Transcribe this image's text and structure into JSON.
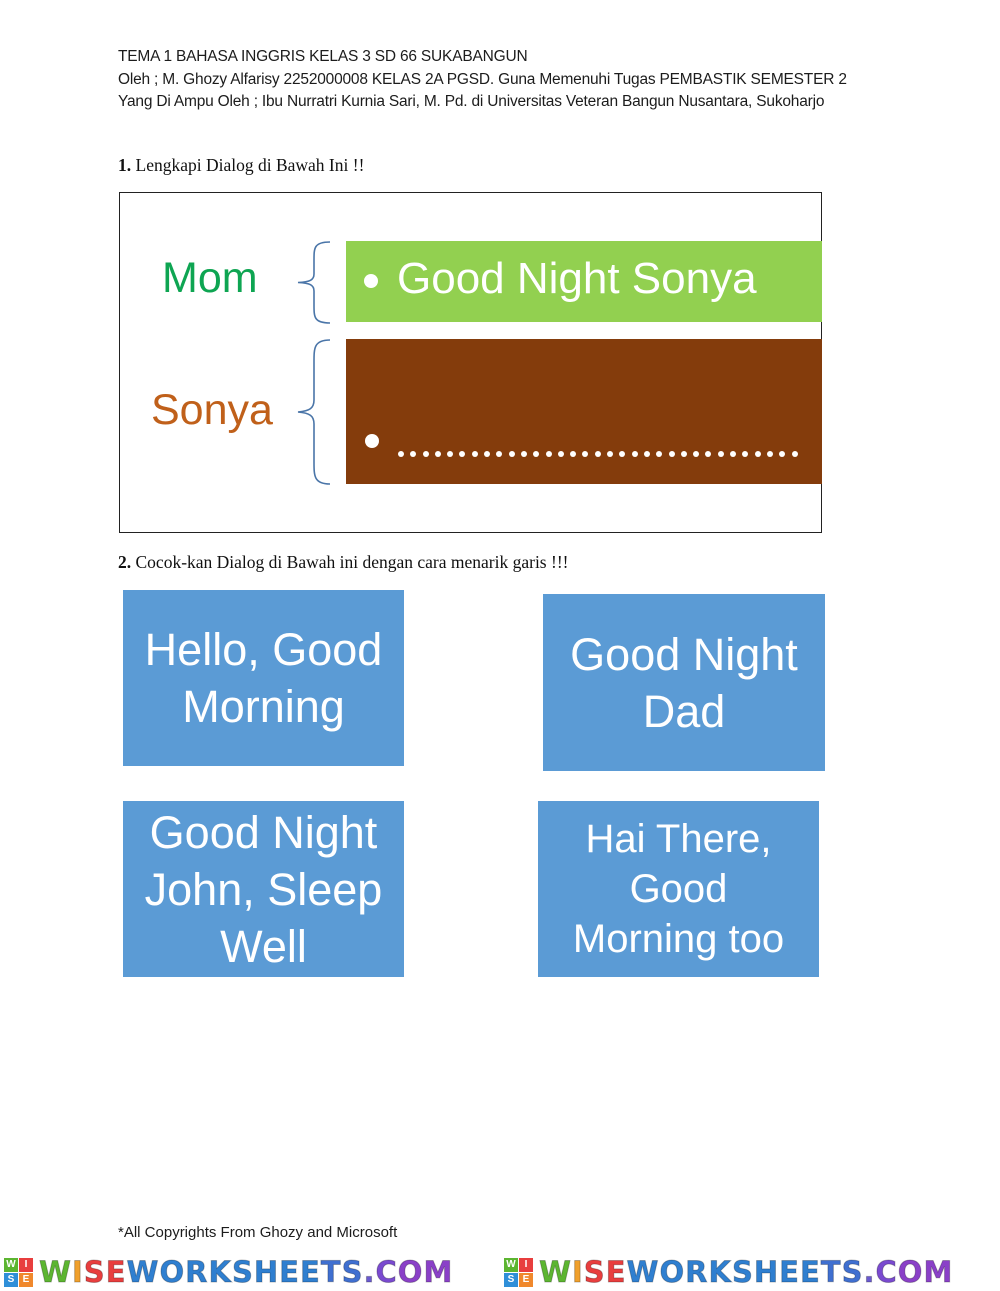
{
  "header": {
    "line1": "TEMA 1 BAHASA INGGRIS KELAS 3 SD 66 SUKABANGUN",
    "line2": "Oleh ; M. Ghozy Alfarisy 2252000008 KELAS 2A PGSD. Guna Memenuhi Tugas PEMBASTIK SEMESTER 2",
    "line3": "Yang Di Ampu Oleh ; Ibu Nurratri Kurnia Sari, M. Pd. di Universitas Veteran Bangun Nusantara, Sukoharjo"
  },
  "question1": {
    "number": "1.",
    "text": "Lengkapi Dialog di Bawah Ini !!",
    "dialog": [
      {
        "speaker": "Mom",
        "line": "Good Night Sonya",
        "speaker_color": "#0ea552",
        "box_color": "#92d050"
      },
      {
        "speaker": "Sonya",
        "line": "",
        "blank_dots": 33,
        "speaker_color": "#c0601a",
        "box_color": "#843c0c"
      }
    ]
  },
  "question2": {
    "number": "2.",
    "text": "Cocok-kan Dialog di Bawah ini dengan cara menarik garis !!!",
    "cards": [
      {
        "lines": [
          "Hello, Good",
          "Morning"
        ]
      },
      {
        "lines": [
          "Good Night",
          "Dad"
        ]
      },
      {
        "lines": [
          "Good Night",
          "John, Sleep",
          "Well"
        ]
      },
      {
        "lines": [
          "Hai There,",
          "Good",
          "Morning too"
        ]
      }
    ],
    "card_color": "#5b9bd5"
  },
  "footer": {
    "copyright": "*All Copyrights From Ghozy and Microsoft"
  },
  "watermark": {
    "logo_letters": [
      "W",
      "I",
      "S",
      "E"
    ],
    "logo_colors": [
      "#5cb531",
      "#e83e3e",
      "#2f8fd8",
      "#f0882c"
    ],
    "text": "WISEWORKSHEETS.COM"
  }
}
